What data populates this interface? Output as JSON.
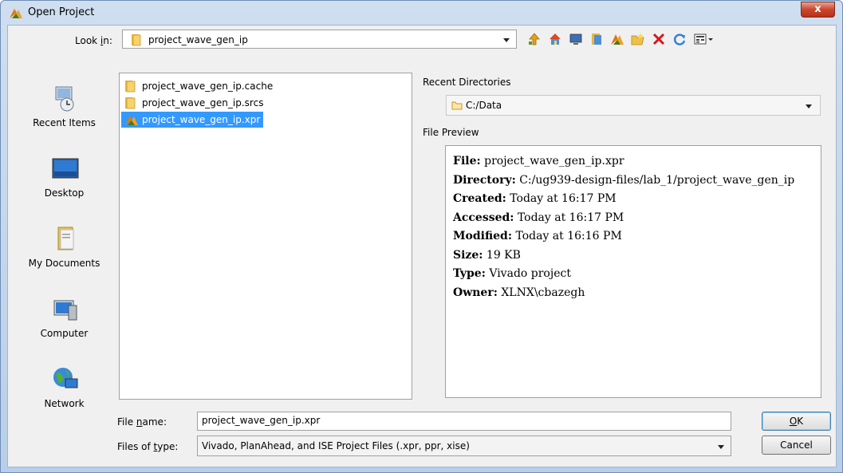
{
  "window": {
    "title": "Open Project",
    "close_glyph": "x"
  },
  "lookin": {
    "label_pre": "Look ",
    "label_u": "i",
    "label_post": "n:",
    "value": "project_wave_gen_ip"
  },
  "toolbar": {
    "icons": [
      "up-folder-icon",
      "home-icon",
      "desktop-icon",
      "documents-icon",
      "project-icon",
      "new-folder-icon",
      "delete-icon",
      "refresh-icon",
      "view-menu-icon"
    ]
  },
  "places": [
    {
      "label": "Recent Items",
      "icon": "recent-items-icon"
    },
    {
      "label": "Desktop",
      "icon": "desktop-icon"
    },
    {
      "label": "My Documents",
      "icon": "my-documents-icon"
    },
    {
      "label": "Computer",
      "icon": "computer-icon"
    },
    {
      "label": "Network",
      "icon": "network-icon"
    }
  ],
  "files": [
    {
      "name": "project_wave_gen_ip.cache",
      "icon": "folder-icon"
    },
    {
      "name": "project_wave_gen_ip.srcs",
      "icon": "folder-icon"
    },
    {
      "name": "project_wave_gen_ip.xpr",
      "icon": "vivado-project-icon",
      "selected": true
    }
  ],
  "recent": {
    "label": "Recent Directories",
    "value": "C:/Data"
  },
  "preview": {
    "label": "File Preview",
    "rows": [
      {
        "key": "File:",
        "value": "project_wave_gen_ip.xpr"
      },
      {
        "key": "Directory:",
        "value": "C:/ug939-design-files/lab_1/project_wave_gen_ip"
      },
      {
        "key": "Created:",
        "value": "Today at 16:17 PM"
      },
      {
        "key": "Accessed:",
        "value": "Today at 16:17 PM"
      },
      {
        "key": "Modified:",
        "value": "Today at 16:16 PM"
      },
      {
        "key": "Size:",
        "value": "19 KB"
      },
      {
        "key": "Type:",
        "value": "Vivado project"
      },
      {
        "key": "Owner:",
        "value": "XLNX\\cbazegh"
      }
    ]
  },
  "filename": {
    "label_pre": "File ",
    "label_u": "n",
    "label_post": "ame:",
    "value": "project_wave_gen_ip.xpr"
  },
  "filetype": {
    "label_pre": "Files of ",
    "label_u": "t",
    "label_post": "ype:",
    "value": "Vivado, PlanAhead, and ISE Project Files (.xpr, ppr, xise)"
  },
  "buttons": {
    "ok_u": "O",
    "ok_rest": "K",
    "cancel": "Cancel"
  }
}
